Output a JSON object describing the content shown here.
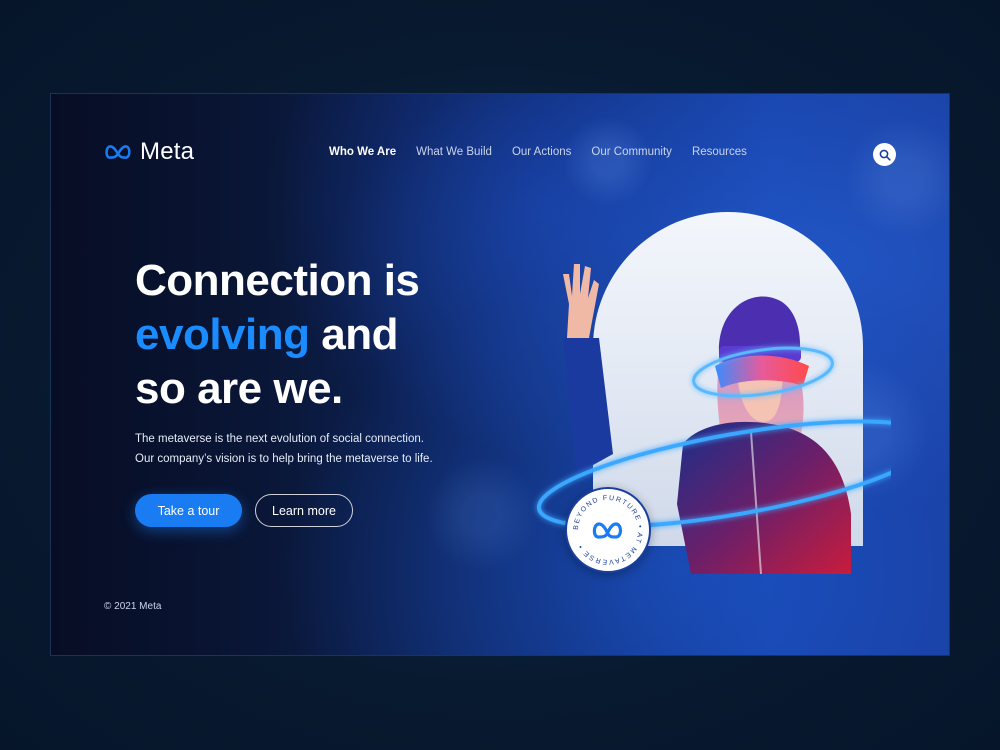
{
  "brand": {
    "name": "Meta"
  },
  "nav": {
    "items": [
      {
        "label": "Who We Are",
        "active": true
      },
      {
        "label": "What We Build",
        "active": false
      },
      {
        "label": "Our Actions",
        "active": false
      },
      {
        "label": "Our Community",
        "active": false
      },
      {
        "label": "Resources",
        "active": false
      }
    ]
  },
  "hero": {
    "headline_line1": "Connection is",
    "headline_accent": "evolving",
    "headline_line2_rest": " and",
    "headline_line3": "so are we.",
    "description_line1": "The metaverse is the next evolution of social connection.",
    "description_line2": "Our company’s vision is to help bring the metaverse to life.",
    "primary_button": "Take a tour",
    "secondary_button": "Learn more"
  },
  "badge": {
    "ring_text": "BEYOND FURTURE • AT METAVERSE •"
  },
  "footer": {
    "copyright": "© 2021 Meta"
  },
  "colors": {
    "accent": "#1a8cff",
    "primary_button": "#1a7cf2",
    "background": "#081a30"
  },
  "icons": {
    "search": "search-icon",
    "logo": "meta-infinity-icon"
  }
}
